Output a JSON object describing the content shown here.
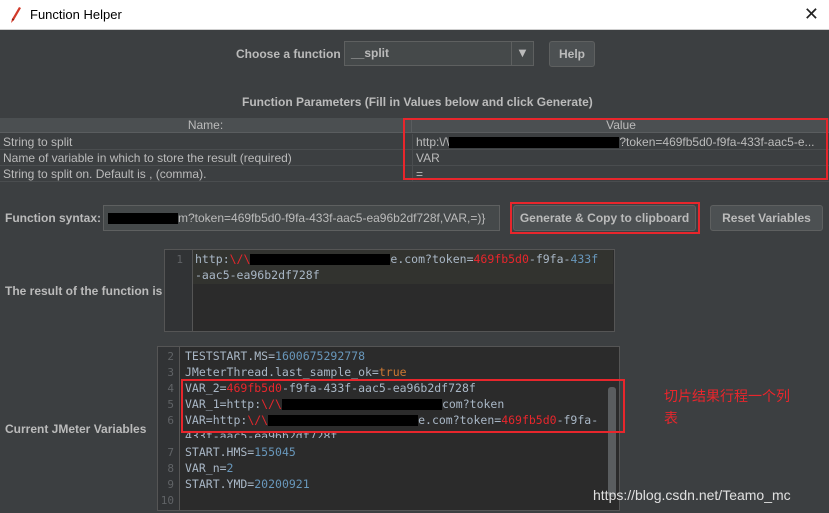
{
  "window": {
    "title": "Function Helper",
    "close_glyph": "✕",
    "icon": "feather-icon"
  },
  "chooser": {
    "label": "Choose a function",
    "selected": "__split",
    "help_label": "Help"
  },
  "params": {
    "heading": "Function Parameters (Fill in Values below and click Generate)",
    "col_name": "Name:",
    "col_value": "Value",
    "rows": [
      {
        "name": "String to split",
        "value_prefix": "http:\\/\\",
        "value_suffix": "?token=469fb5d0-f9fa-433f-aac5-e..."
      },
      {
        "name": "Name of variable in which to store the result (required)",
        "value": "VAR"
      },
      {
        "name": "String to split on. Default is , (comma).",
        "value": "="
      }
    ]
  },
  "syntax": {
    "label": "Function syntax:",
    "value_suffix": "m?token=469fb5d0-f9fa-433f-aac5-ea96b2df728f,VAR,=)}",
    "generate_label": "Generate & Copy to clipboard",
    "reset_label": "Reset Variables"
  },
  "result": {
    "label": "The result of the function is",
    "line_no": "1",
    "line1_prefix": "http:",
    "line1_red1": "\\/\\",
    "line1_tail": "e.com?token=",
    "line1_red2": "469fb5d0",
    "line1_mid": "-f9fa-",
    "line1_red3": "433f",
    "line2": "-aac5-ea96b2df728f"
  },
  "variables": {
    "label": "Current JMeter Variables",
    "lines": [
      {
        "n": "2",
        "key": "TESTSTART.MS=",
        "num": "1600675292778"
      },
      {
        "n": "3",
        "key": "JMeterThread.last_sample_ok=",
        "kw": "true"
      },
      {
        "n": "4",
        "key": "VAR_2=",
        "red": "469fb5d0",
        "rest": "-f9fa-433f-aac5-ea96b2df728f"
      },
      {
        "n": "5",
        "key": "VAR_1=http:",
        "red": "\\/\\",
        "rest": "com?token"
      },
      {
        "n": "6",
        "key": "VAR=http:",
        "red": "\\/\\",
        "rest": "e.com?token=",
        "red2": "469fb5d0",
        "rest2": "-f9fa-"
      },
      {
        "n": "",
        "key": "433f-aac5-ea96b2df728f"
      },
      {
        "n": "7",
        "key": "START.HMS=",
        "num": "155045"
      },
      {
        "n": "8",
        "key": "VAR_n=",
        "num": "2"
      },
      {
        "n": "9",
        "key": "START.YMD=",
        "num": "20200921"
      },
      {
        "n": "10",
        "key": ""
      }
    ]
  },
  "annotation": {
    "line1": "切片结果行程一个列",
    "line2": "表"
  },
  "watermark": "https://blog.csdn.net/Teamo_mc",
  "colors": {
    "accent_red": "#e8262c",
    "bg": "#3c3f41",
    "editor_bg": "#2b2b2b"
  }
}
